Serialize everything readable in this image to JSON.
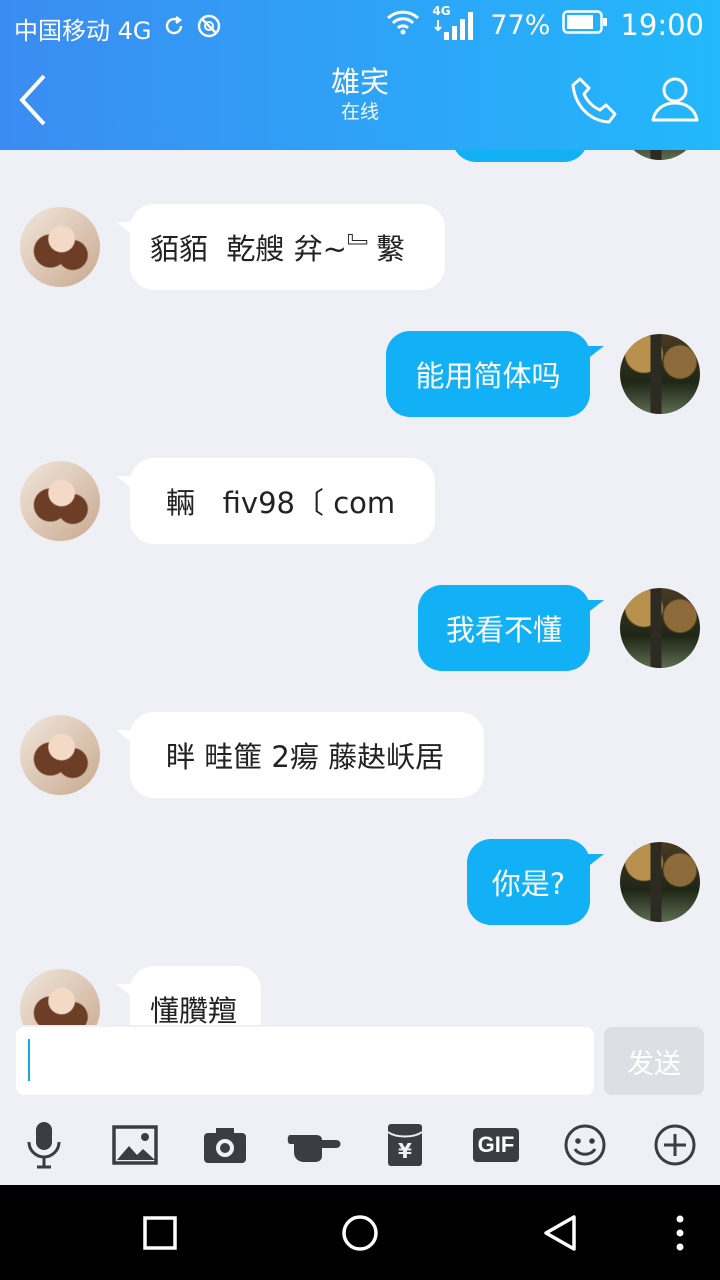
{
  "status_bar": {
    "carrier": "中国移动 4G",
    "network_badge": "4G",
    "battery": "77%",
    "time": "19:00"
  },
  "header": {
    "title": "雄宎",
    "subtitle": "在线"
  },
  "messages": [
    {
      "side": "in",
      "text": "貊貊  乾艘 弅~﹄繫"
    },
    {
      "side": "out",
      "text": "能用简体吗"
    },
    {
      "side": "in",
      "text": "輛   fiv98〔 com"
    },
    {
      "side": "out",
      "text": "我看不懂"
    },
    {
      "side": "in",
      "text": "眫 畦篚 2瘍 藤赽岆居"
    },
    {
      "side": "out",
      "text": "你是?"
    },
    {
      "side": "in",
      "text": "懂臢羶"
    }
  ],
  "composer": {
    "value": "",
    "send_label": "发送"
  },
  "toolbar": {
    "gif_label": "GIF",
    "icons": [
      "microphone-icon",
      "image-icon",
      "camera-icon",
      "poke-hand-icon",
      "red-packet-icon",
      "gif-icon",
      "emoji-icon",
      "plus-icon"
    ]
  },
  "nav": {
    "icons": [
      "recents-square-icon",
      "home-circle-icon",
      "back-triangle-icon",
      "more-dots-icon"
    ]
  },
  "colors": {
    "header_start": "#3b8cf2",
    "header_end": "#22b8fb",
    "bubble_out": "#12b0f5",
    "bubble_in": "#ffffff",
    "background": "#eef0f5"
  }
}
